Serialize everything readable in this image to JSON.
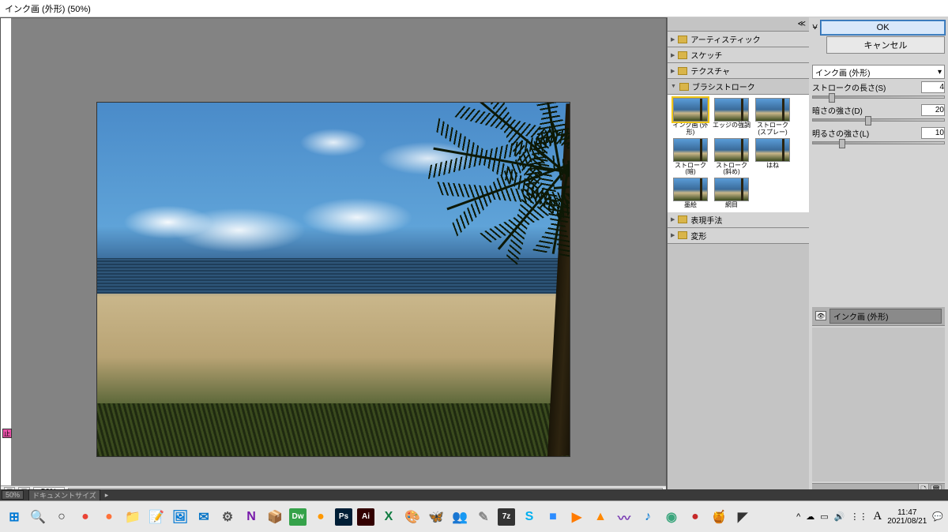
{
  "titlebar": {
    "title": "インク画 (外形) (50%)"
  },
  "status": {
    "zoom": "50%"
  },
  "ruler_marker": "止",
  "filter_categories": {
    "artistic": "アーティスティック",
    "sketch": "スケッチ",
    "texture": "テクスチャ",
    "brush": "ブラシストローク",
    "stylize": "表現手法",
    "distort": "変形"
  },
  "brush_thumbs": [
    {
      "label": "インク画 (外形)",
      "selected": true
    },
    {
      "label": "エッジの強調",
      "selected": false
    },
    {
      "label": "ストローク(スプレー)",
      "selected": false
    },
    {
      "label": "ストローク(暗)",
      "selected": false
    },
    {
      "label": "ストローク(斜め)",
      "selected": false
    },
    {
      "label": "はね",
      "selected": false
    },
    {
      "label": "墨絵",
      "selected": false
    },
    {
      "label": "網目",
      "selected": false
    }
  ],
  "controls": {
    "ok": "OK",
    "cancel": "キャンセル",
    "selected_filter": "インク画 (外形)",
    "sliders": [
      {
        "label": "ストロークの長さ(S)",
        "value": "4",
        "pos": 12
      },
      {
        "label": "暗さの強さ(D)",
        "value": "20",
        "pos": 40
      },
      {
        "label": "明るさの強さ(L)",
        "value": "10",
        "pos": 20
      }
    ]
  },
  "layers": {
    "title": "インク画 (外形)"
  },
  "taskbar": {
    "icons": [
      {
        "name": "start",
        "glyph": "⊞",
        "color": "#0078d4"
      },
      {
        "name": "search",
        "glyph": "🔍",
        "color": "#333"
      },
      {
        "name": "cortana",
        "glyph": "○",
        "color": "#333"
      },
      {
        "name": "chrome",
        "glyph": "●",
        "color": "#ea4335"
      },
      {
        "name": "firefox",
        "glyph": "●",
        "color": "#ff7139"
      },
      {
        "name": "explorer",
        "glyph": "📁",
        "color": "#f0c818"
      },
      {
        "name": "notes",
        "glyph": "📝",
        "color": "#6aa0d8"
      },
      {
        "name": "photos",
        "glyph": "🖼",
        "color": "#0078d4"
      },
      {
        "name": "outlook",
        "glyph": "✉",
        "color": "#0072c6"
      },
      {
        "name": "settings",
        "glyph": "⚙",
        "color": "#555"
      },
      {
        "name": "onenote",
        "glyph": "N",
        "color": "#7719aa"
      },
      {
        "name": "resources",
        "glyph": "📦",
        "color": "#d97f2e"
      },
      {
        "name": "dreamweaver",
        "glyph": "Dw",
        "color": "#35a24a"
      },
      {
        "name": "sublime",
        "glyph": "●",
        "color": "#ff9800"
      },
      {
        "name": "photoshop",
        "glyph": "Ps",
        "color": "#001e36"
      },
      {
        "name": "illustrator",
        "glyph": "Ai",
        "color": "#330000"
      },
      {
        "name": "excel",
        "glyph": "X",
        "color": "#107c41"
      },
      {
        "name": "paint",
        "glyph": "🎨",
        "color": "#5aa0e8"
      },
      {
        "name": "butterfly",
        "glyph": "🦋",
        "color": "#d97f2e"
      },
      {
        "name": "teams",
        "glyph": "👥",
        "color": "#6264a7"
      },
      {
        "name": "app1",
        "glyph": "✎",
        "color": "#888"
      },
      {
        "name": "7z",
        "glyph": "7z",
        "color": "#333"
      },
      {
        "name": "skype",
        "glyph": "S",
        "color": "#00aff0"
      },
      {
        "name": "zoom",
        "glyph": "■",
        "color": "#2d8cff"
      },
      {
        "name": "media",
        "glyph": "▶",
        "color": "#ff7a00"
      },
      {
        "name": "vlc",
        "glyph": "▲",
        "color": "#ff8800"
      },
      {
        "name": "app2",
        "glyph": "〰",
        "color": "#7b3fb5"
      },
      {
        "name": "music",
        "glyph": "♪",
        "color": "#0078d4"
      },
      {
        "name": "app3",
        "glyph": "◉",
        "color": "#3aa57c"
      },
      {
        "name": "record",
        "glyph": "●",
        "color": "#c62828"
      },
      {
        "name": "app4",
        "glyph": "🍯",
        "color": "#d9a02e"
      },
      {
        "name": "app5",
        "glyph": "◤",
        "color": "#333"
      }
    ],
    "tray": {
      "up": "^",
      "cloud": "☁",
      "battery": "▭",
      "volume": "🔊",
      "wifi": "⋮⋮",
      "ime": "A",
      "time": "11:47",
      "date": "2021/08/21"
    }
  },
  "bottom_bar": {
    "label": "ドキュメントサイズ"
  }
}
